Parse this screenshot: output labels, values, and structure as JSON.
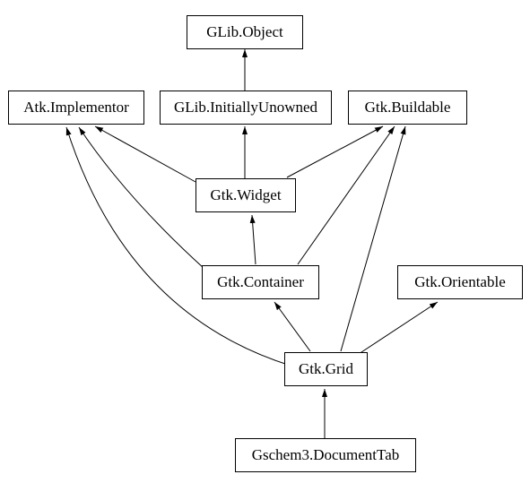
{
  "nodes": {
    "glib_object": "GLib.Object",
    "atk_implementor": "Atk.Implementor",
    "glib_initially_unowned": "GLib.InitiallyUnowned",
    "gtk_buildable": "Gtk.Buildable",
    "gtk_widget": "Gtk.Widget",
    "gtk_container": "Gtk.Container",
    "gtk_orientable": "Gtk.Orientable",
    "gtk_grid": "Gtk.Grid",
    "gschem3_document_tab": "Gschem3.DocumentTab"
  }
}
